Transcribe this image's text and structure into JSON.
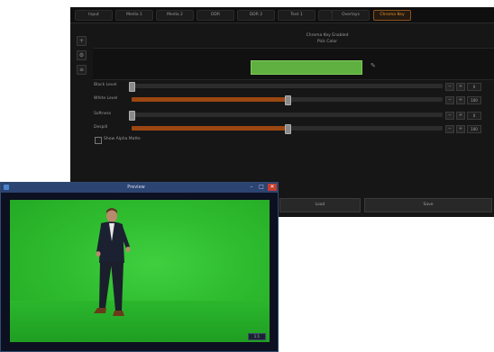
{
  "main_window": {
    "tabs": [
      "Input",
      "Media 1",
      "Media 2",
      "DDR",
      "DDR 2",
      "Text 1",
      "Text 2",
      "Overlays",
      "Chroma Key"
    ],
    "active_tab_index": 8,
    "header_line1": "Chroma Key Enabled",
    "header_line2": "Pick Color",
    "key_color": "#5fb040",
    "sliders": [
      {
        "label": "Black Level",
        "value": 0,
        "display": "0"
      },
      {
        "label": "White Level",
        "value": 0.5,
        "display": "100"
      },
      {
        "label": "Softness",
        "value": 0,
        "display": "0"
      },
      {
        "label": "Despill",
        "value": 0.5,
        "display": "100"
      }
    ],
    "checkbox_label": "Show Alpha Matte",
    "checkbox_checked": false,
    "buttons": {
      "left": "Load",
      "right": "Save"
    }
  },
  "video_window": {
    "title": "Preview",
    "status": "1:1"
  }
}
